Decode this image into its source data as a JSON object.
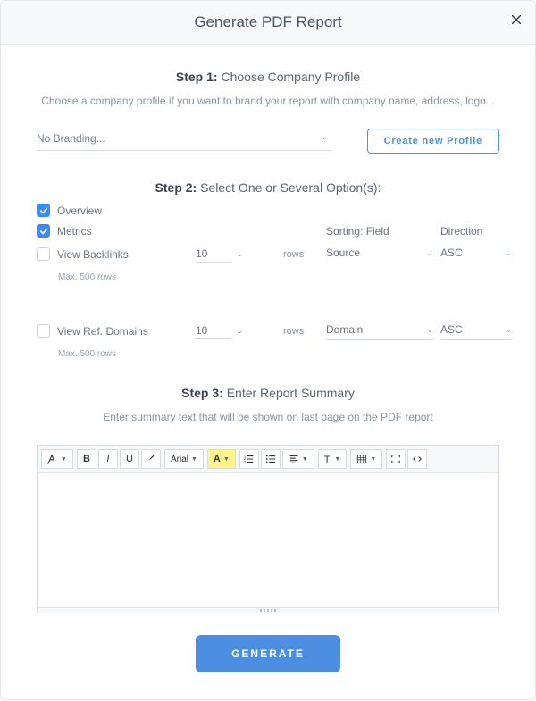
{
  "header": {
    "title": "Generate PDF Report"
  },
  "step1": {
    "label": "Step 1:",
    "title": "Choose Company Profile",
    "desc": "Choose a company profile if you want to brand your report with company name, address, logo...",
    "select_value": "No Branding...",
    "create_button": "Create new Profile"
  },
  "step2": {
    "label": "Step 2:",
    "title": "Select One or Several Option(s):",
    "overview_label": "Overview",
    "metrics_label": "Metrics",
    "backlinks_label": "View Backlinks",
    "refdomains_label": "View Ref. Domains",
    "backlinks_rows": "10",
    "refdomains_rows": "10",
    "rows_label": "rows",
    "max_note": "Max. 500 rows",
    "sorting_label": "Sorting: Field",
    "direction_label": "Direction",
    "backlinks_sort_field": "Source",
    "backlinks_sort_dir": "ASC",
    "refdomains_sort_field": "Domain",
    "refdomains_sort_dir": "ASC"
  },
  "step3": {
    "label": "Step 3:",
    "title": "Enter Report Summary",
    "desc": "Enter summary text that will be shown on last page on the PDF report",
    "toolbar": {
      "font_label": "Arial",
      "highlight_letter": "A",
      "bold": "B",
      "italic": "I",
      "underline": "U",
      "txicon": "Tⁱ"
    }
  },
  "generate_label": "GENERATE"
}
